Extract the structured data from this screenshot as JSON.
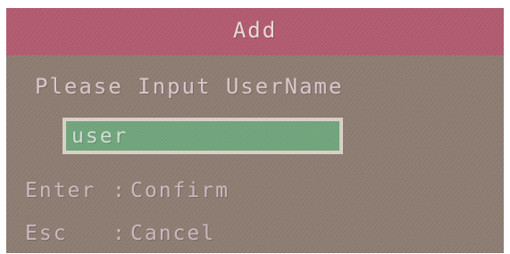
{
  "dialog": {
    "title": "Add",
    "prompt": "Please Input UserName",
    "username_value": "user",
    "hints": [
      {
        "key": "Enter",
        "separator": ":",
        "action": "Confirm"
      },
      {
        "key": "Esc",
        "separator": ":",
        "action": "Cancel"
      }
    ]
  },
  "colors": {
    "dialog_background": "#8d7c72",
    "titlebar_background": "#b25a70",
    "input_background": "#6fa37a",
    "input_border": "#d9d0c5"
  }
}
